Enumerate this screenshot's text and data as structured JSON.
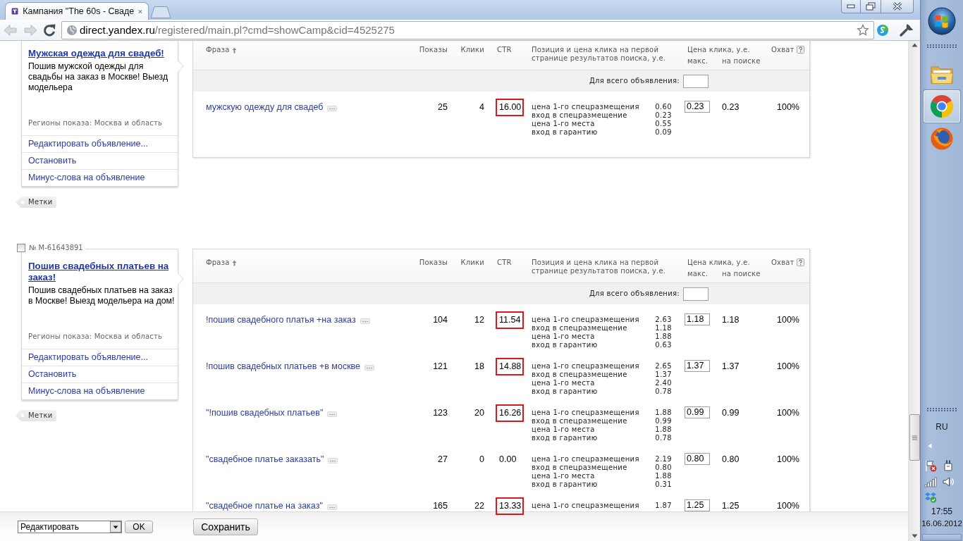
{
  "browser": {
    "tab_title": "Кампания \"The 60s - Сваде",
    "url_host": "direct.yandex.ru",
    "url_path": "/registered/main.pl?cmd=showCamp&cid=4525275"
  },
  "ads": [
    {
      "title": "Мужская одежда для свадеб!",
      "text": "Пошив мужской одежды для свадьбы на заказ в Москве! Выезд модельера",
      "regions": "Регионы показа: Москва и область",
      "actions": [
        "Редактировать объявление...",
        "Остановить",
        "Минус-слова на объявление"
      ],
      "tags_button": "Метки",
      "table": {
        "columns": {
          "phrase": "Фраза",
          "impressions": "Показы",
          "clicks": "Клики",
          "ctr": "CTR",
          "position": "Позиция и цена клика на первой странице результатов поиска, у.е.",
          "price": "Цена клика, у.е.",
          "price_max": "макс.",
          "price_search": "на поиске",
          "coverage": "Охват"
        },
        "whole_ad_label": "Для всего объявления:",
        "rows": [
          {
            "phrase": "мужскую одежду для свадеб",
            "impressions": "25",
            "clicks": "4",
            "ctr": "16.00",
            "highlighted": true,
            "positions": [
              {
                "label": "цена 1-го спецразмещения",
                "value": "0.60"
              },
              {
                "label": "вход в спецразмещение",
                "value": "0.23"
              },
              {
                "label": "цена 1-го места",
                "value": "0.55"
              },
              {
                "label": "вход в гарантию",
                "value": "0.09"
              }
            ],
            "max_price": "0.23",
            "search_price": "0.23",
            "coverage": "100%"
          }
        ]
      }
    },
    {
      "number": "№ M-61643891",
      "checked": false,
      "title": "Пошив свадебных платьев на заказ!",
      "text": "Пошив свадебных платьев на заказ в Москве! Выезд модельера на дом!",
      "regions": "Регионы показа: Москва и область",
      "actions": [
        "Редактировать объявление...",
        "Остановить",
        "Минус-слова на объявление"
      ],
      "tags_button": "Метки",
      "table": {
        "columns": {
          "phrase": "Фраза",
          "impressions": "Показы",
          "clicks": "Клики",
          "ctr": "CTR",
          "position": "Позиция и цена клика на первой странице результатов поиска, у.е.",
          "price": "Цена клика, у.е.",
          "price_max": "макс.",
          "price_search": "на поиске",
          "coverage": "Охват"
        },
        "whole_ad_label": "Для всего объявления:",
        "rows": [
          {
            "phrase": "!пошив свадебного платья +на заказ",
            "impressions": "104",
            "clicks": "12",
            "ctr": "11.54",
            "highlighted": true,
            "positions": [
              {
                "label": "цена 1-го спецразмещения",
                "value": "2.63"
              },
              {
                "label": "вход в спецразмещение",
                "value": "1.18"
              },
              {
                "label": "цена 1-го места",
                "value": "1.88"
              },
              {
                "label": "вход в гарантию",
                "value": "0.63"
              }
            ],
            "max_price": "1.18",
            "search_price": "1.18",
            "coverage": "100%"
          },
          {
            "phrase": "!пошив свадебных платьев +в москве",
            "impressions": "121",
            "clicks": "18",
            "ctr": "14.88",
            "highlighted": true,
            "positions": [
              {
                "label": "цена 1-го спецразмещения",
                "value": "2.65"
              },
              {
                "label": "вход в спецразмещение",
                "value": "1.37"
              },
              {
                "label": "цена 1-го места",
                "value": "2.40"
              },
              {
                "label": "вход в гарантию",
                "value": "0.78"
              }
            ],
            "max_price": "1.37",
            "search_price": "1.37",
            "coverage": "100%"
          },
          {
            "phrase": "\"!пошив свадебных платьев\"",
            "impressions": "123",
            "clicks": "20",
            "ctr": "16.26",
            "highlighted": true,
            "positions": [
              {
                "label": "цена 1-го спецразмещения",
                "value": "1.88"
              },
              {
                "label": "вход в спецразмещение",
                "value": "0.99"
              },
              {
                "label": "цена 1-го места",
                "value": "1.88"
              },
              {
                "label": "вход в гарантию",
                "value": "0.78"
              }
            ],
            "max_price": "0.99",
            "search_price": "0.99",
            "coverage": "100%"
          },
          {
            "phrase": "\"свадебное платье заказать\"",
            "impressions": "27",
            "clicks": "0",
            "ctr": "0.00",
            "highlighted": false,
            "positions": [
              {
                "label": "цена 1-го спецразмещения",
                "value": "2.19"
              },
              {
                "label": "вход в спецразмещение",
                "value": "0.80"
              },
              {
                "label": "цена 1-го места",
                "value": "1.88"
              },
              {
                "label": "вход в гарантию",
                "value": "0.31"
              }
            ],
            "max_price": "0.80",
            "search_price": "0.80",
            "coverage": "100%"
          },
          {
            "phrase": "\"свадебное платье на заказ\"",
            "impressions": "165",
            "clicks": "22",
            "ctr": "13.33",
            "highlighted": true,
            "positions": [
              {
                "label": "цена 1-го спецразмещения",
                "value": "1.87"
              }
            ],
            "max_price": "1.25",
            "search_price": "1.25",
            "coverage": "100%"
          }
        ]
      }
    }
  ],
  "bottom_bar": {
    "action_select": "Редактировать",
    "ok_button": "OK",
    "save_button": "Сохранить"
  },
  "taskbar": {
    "apps": [
      {
        "kind": "folder",
        "selected": false
      },
      {
        "kind": "chrome",
        "selected": true
      },
      {
        "kind": "firefox",
        "selected": false
      }
    ],
    "language": "RU",
    "time": "17:55",
    "date": "16.06.2012"
  }
}
